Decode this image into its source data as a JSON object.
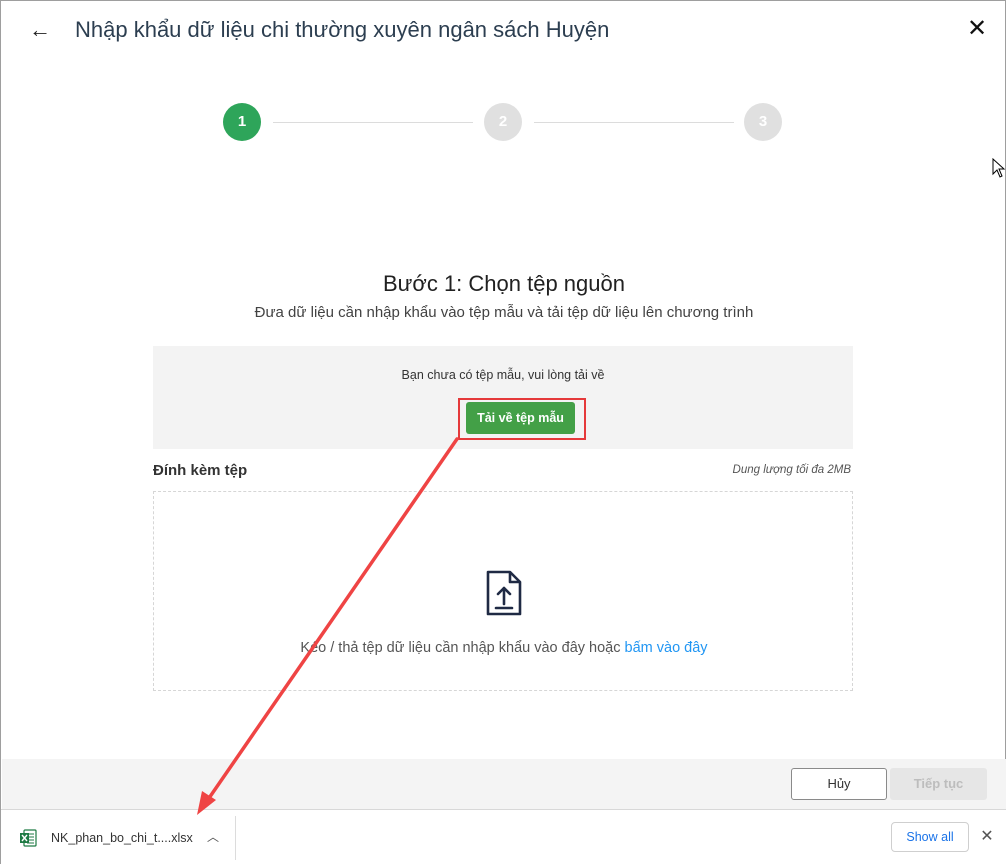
{
  "header": {
    "back_icon": "arrow-left-icon",
    "title": "Nhập khẩu dữ liệu chi thường xuyên ngân sách Huyện",
    "close_icon": "close-icon"
  },
  "stepper": {
    "steps": [
      {
        "label": "1",
        "active": true
      },
      {
        "label": "2",
        "active": false
      },
      {
        "label": "3",
        "active": false
      }
    ],
    "active_color": "#2ea55a"
  },
  "step": {
    "title": "Bước 1: Chọn tệp nguồn",
    "description": "Đưa dữ liệu cần nhập khẩu vào tệp mẫu và tải tệp dữ liệu lên chương trình"
  },
  "template": {
    "message": "Bạn chưa có tệp mẫu, vui lòng tải về",
    "download_label": "Tải về tệp mẫu"
  },
  "attach": {
    "label": "Đính kèm tệp",
    "max_size": "Dung lượng tối đa 2MB",
    "drop_text": "Kéo / thả tệp dữ liệu cần nhập khẩu vào đây hoặc ",
    "drop_link": "bấm vào đây",
    "upload_icon": "file-upload-icon"
  },
  "footer": {
    "cancel_label": "Hủy",
    "next_label": "Tiếp tục"
  },
  "download_bar": {
    "file_name": "NK_phan_bo_chi_t....xlsx",
    "file_icon": "excel-file-icon",
    "show_all_label": "Show all"
  },
  "colors": {
    "primary_green": "#43a047",
    "highlight_red": "#e5393a",
    "link_blue": "#2196f3"
  }
}
